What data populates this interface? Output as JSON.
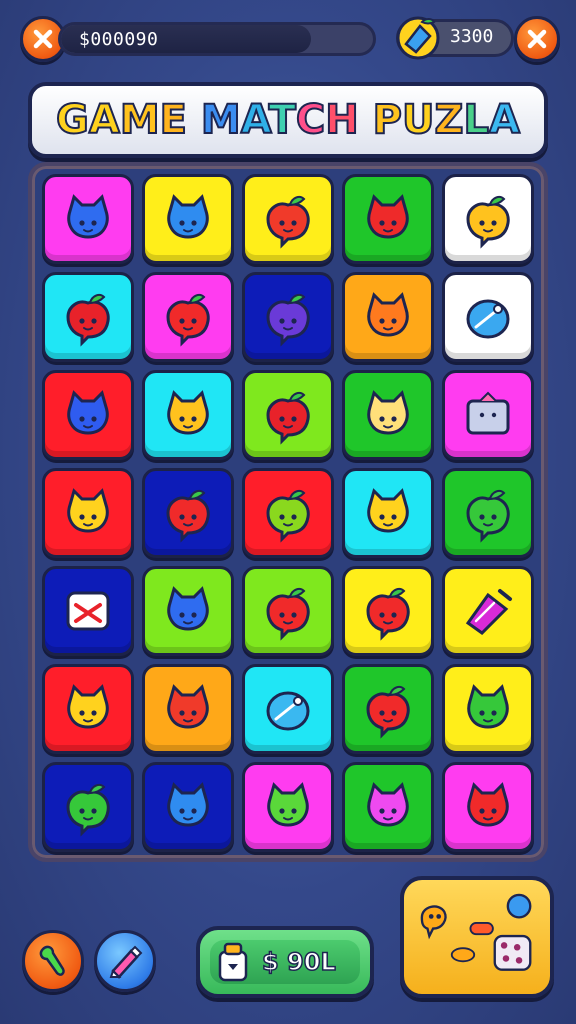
{
  "header": {
    "coins_text": "$000090",
    "coins_progress": 0.8,
    "gems_text": "3300",
    "close_left_icon": "close-x-icon",
    "close_right_icon": "close-x-icon",
    "gem_icon": "blue-gem-icon"
  },
  "title": {
    "letters": [
      {
        "ch": "G",
        "color": "#ffd21e"
      },
      {
        "ch": "A",
        "color": "#ffd21e"
      },
      {
        "ch": "M",
        "color": "#ffc21e"
      },
      {
        "ch": "E",
        "color": "#ffb41e"
      },
      {
        "ch": " ",
        "color": "#ffffff"
      },
      {
        "ch": "M",
        "color": "#3b8df0"
      },
      {
        "ch": "A",
        "color": "#2fb0e8"
      },
      {
        "ch": "T",
        "color": "#3fd0b0"
      },
      {
        "ch": "C",
        "color": "#ff4f8a"
      },
      {
        "ch": "H",
        "color": "#ff4f6a"
      },
      {
        "ch": " ",
        "color": "#ffffff"
      },
      {
        "ch": "P",
        "color": "#ffc21e"
      },
      {
        "ch": "U",
        "color": "#ffd21e"
      },
      {
        "ch": "Z",
        "color": "#ffb41e"
      },
      {
        "ch": "L",
        "color": "#4ad08a"
      },
      {
        "ch": "A",
        "color": "#3bb8f0"
      }
    ]
  },
  "board": {
    "rows": 7,
    "cols": 5,
    "tiles": [
      {
        "bg": "#ff3cf0",
        "item": "blue-cat-icon",
        "itemColor": "#2f6cf0"
      },
      {
        "bg": "#ffee1a",
        "item": "blue-cat-icon",
        "itemColor": "#2f8cf0"
      },
      {
        "bg": "#ffee1a",
        "item": "red-apple-icon",
        "itemColor": "#f03a2a"
      },
      {
        "bg": "#1fc62a",
        "item": "red-cat-icon",
        "itemColor": "#ee2a2a"
      },
      {
        "bg": "#ffffff",
        "item": "yellow-blob-icon",
        "itemColor": "#ffc21e"
      },
      {
        "bg": "#20e6f5",
        "item": "red-apple-icon",
        "itemColor": "#e8222a"
      },
      {
        "bg": "#ff3cf0",
        "item": "red-apple-icon",
        "itemColor": "#f02a2a"
      },
      {
        "bg": "#0d1cb8",
        "item": "purple-apple-icon",
        "itemColor": "#6a3ad8"
      },
      {
        "bg": "#ffa818",
        "item": "orange-cat-icon",
        "itemColor": "#ff7a1e"
      },
      {
        "bg": "#ffffff",
        "item": "blue-pin-icon",
        "itemColor": "#3aa8f0"
      },
      {
        "bg": "#ff1e2a",
        "item": "blue-cat-icon",
        "itemColor": "#2f5cf0"
      },
      {
        "bg": "#20e6f5",
        "item": "yellow-cat-icon",
        "itemColor": "#ffc21e"
      },
      {
        "bg": "#7fe81e",
        "item": "red-apple-icon",
        "itemColor": "#e8222a"
      },
      {
        "bg": "#1fc62a",
        "item": "cream-cat-icon",
        "itemColor": "#ffe07a"
      },
      {
        "bg": "#ff3cf0",
        "item": "grey-box-icon",
        "itemColor": "#c8d0ea"
      },
      {
        "bg": "#ff1e2a",
        "item": "yellow-cat-icon",
        "itemColor": "#ffd21e"
      },
      {
        "bg": "#0d1cb8",
        "item": "red-apple-icon",
        "itemColor": "#f02a2a"
      },
      {
        "bg": "#ff1e2a",
        "item": "green-apple-icon",
        "itemColor": "#8ad81e"
      },
      {
        "bg": "#20e6f5",
        "item": "yellow-cat-icon",
        "itemColor": "#ffd21e"
      },
      {
        "bg": "#1fc62a",
        "item": "green-apple-icon",
        "itemColor": "#36c83a"
      },
      {
        "bg": "#0d1cb8",
        "item": "white-bow-icon",
        "itemColor": "#ffffff"
      },
      {
        "bg": "#7fe81e",
        "item": "blue-cat-icon",
        "itemColor": "#2f6cf0"
      },
      {
        "bg": "#7fe81e",
        "item": "red-apple-icon",
        "itemColor": "#f02a2a"
      },
      {
        "bg": "#ffee1a",
        "item": "red-apple-icon",
        "itemColor": "#f02a2a"
      },
      {
        "bg": "#ffee1a",
        "item": "purple-gem-icon",
        "itemColor": "#d82ad8"
      },
      {
        "bg": "#ff1e2a",
        "item": "yellow-cat-icon",
        "itemColor": "#ffd21e"
      },
      {
        "bg": "#ffa818",
        "item": "red-cat-icon",
        "itemColor": "#f03a2a"
      },
      {
        "bg": "#20e6f5",
        "item": "blue-pin-icon",
        "itemColor": "#3ab8f0"
      },
      {
        "bg": "#1fc62a",
        "item": "red-apple-icon",
        "itemColor": "#f02a2a"
      },
      {
        "bg": "#ffee1a",
        "item": "green-cat-icon",
        "itemColor": "#36c83a"
      },
      {
        "bg": "#0d1cb8",
        "item": "green-apple-icon",
        "itemColor": "#36c83a"
      },
      {
        "bg": "#0d1cb8",
        "item": "blue-cat-icon",
        "itemColor": "#2f8cf0"
      },
      {
        "bg": "#ff3cf0",
        "item": "green-cat-icon",
        "itemColor": "#5ad83a"
      },
      {
        "bg": "#1fc62a",
        "item": "pink-cat-icon",
        "itemColor": "#ee4af0"
      },
      {
        "bg": "#ff3cf0",
        "item": "red-cat-icon",
        "itemColor": "#f02a2a"
      }
    ]
  },
  "footer": {
    "left_button_icon": "green-wrench-icon",
    "second_button_icon": "pencil-icon",
    "score_text": "$ 90L",
    "score_icon": "jar-icon",
    "preview_icon": "item-preview-icon"
  },
  "colors": {
    "background": "#34488a",
    "accent_orange": "#f05a12",
    "outline": "#1d2550"
  }
}
